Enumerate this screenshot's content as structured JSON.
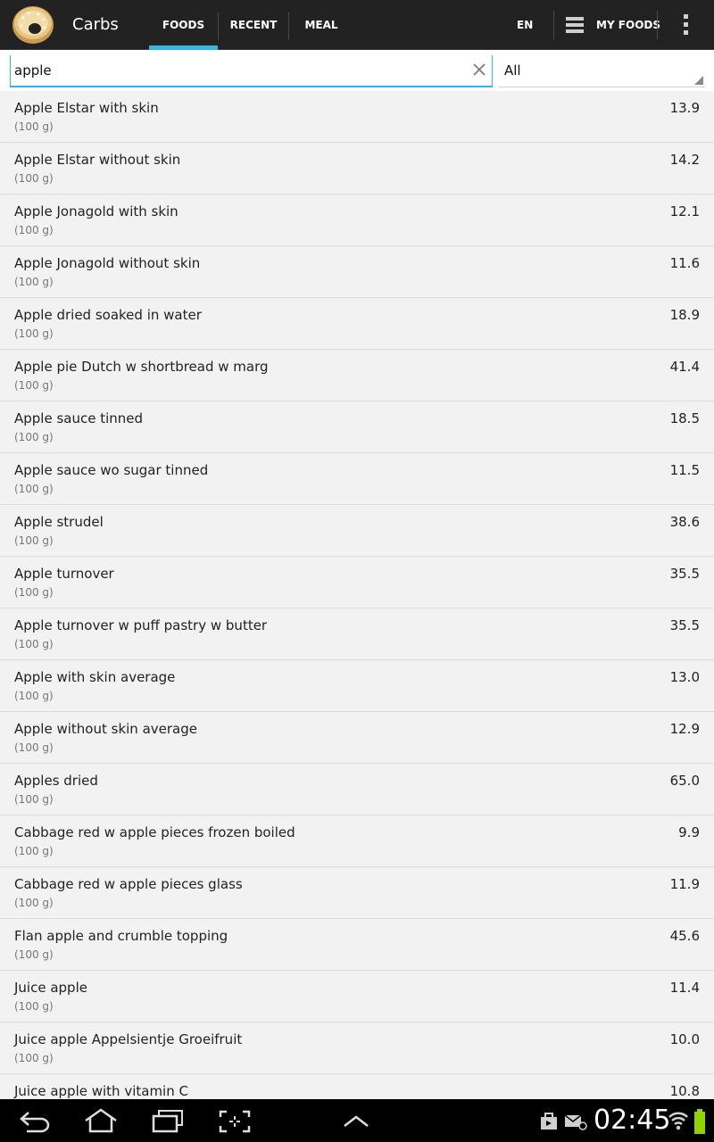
{
  "actionbar": {
    "title": "Carbs",
    "app_icon": "bagel-logo",
    "tabs": [
      {
        "label": "FOODS",
        "selected": true
      },
      {
        "label": "RECENT",
        "selected": false
      },
      {
        "label": "MEAL",
        "selected": false
      }
    ],
    "language": "EN",
    "my_foods_label": "MY FOODS",
    "overflow_icon": "overflow-menu-icon",
    "accent_color": "#33b5e5"
  },
  "search": {
    "value": "apple",
    "clear_icon": "clear-x-icon",
    "filter_value": "All"
  },
  "foods": [
    {
      "name": "Apple Elstar with skin",
      "portion": "(100 g)",
      "carbs": "13.9"
    },
    {
      "name": "Apple Elstar without skin",
      "portion": "(100 g)",
      "carbs": "14.2"
    },
    {
      "name": "Apple Jonagold with skin",
      "portion": "(100 g)",
      "carbs": "12.1"
    },
    {
      "name": "Apple Jonagold without skin",
      "portion": "(100 g)",
      "carbs": "11.6"
    },
    {
      "name": "Apple dried soaked in water",
      "portion": "(100 g)",
      "carbs": "18.9"
    },
    {
      "name": "Apple pie Dutch w shortbread w marg",
      "portion": "(100 g)",
      "carbs": "41.4"
    },
    {
      "name": "Apple sauce tinned",
      "portion": "(100 g)",
      "carbs": "18.5"
    },
    {
      "name": "Apple sauce wo sugar tinned",
      "portion": "(100 g)",
      "carbs": "11.5"
    },
    {
      "name": "Apple strudel",
      "portion": "(100 g)",
      "carbs": "38.6"
    },
    {
      "name": "Apple turnover",
      "portion": "(100 g)",
      "carbs": "35.5"
    },
    {
      "name": "Apple turnover w puff pastry w butter",
      "portion": "(100 g)",
      "carbs": "35.5"
    },
    {
      "name": "Apple with skin average",
      "portion": "(100 g)",
      "carbs": "13.0"
    },
    {
      "name": "Apple without skin average",
      "portion": "(100 g)",
      "carbs": "12.9"
    },
    {
      "name": "Apples dried",
      "portion": "(100 g)",
      "carbs": "65.0"
    },
    {
      "name": "Cabbage red w apple pieces frozen boiled",
      "portion": "(100 g)",
      "carbs": "9.9"
    },
    {
      "name": "Cabbage red w apple pieces glass",
      "portion": "(100 g)",
      "carbs": "11.9"
    },
    {
      "name": "Flan apple and crumble topping",
      "portion": "(100 g)",
      "carbs": "45.6"
    },
    {
      "name": "Juice apple",
      "portion": "(100 g)",
      "carbs": "11.4"
    },
    {
      "name": "Juice apple Appelsientje Groeifruit",
      "portion": "(100 g)",
      "carbs": "10.0"
    },
    {
      "name": "Juice apple with vitamin C",
      "portion": "(100 g)",
      "carbs": "10.8"
    }
  ],
  "system_bar": {
    "clock": "02:45",
    "icons": [
      "back-icon",
      "home-icon",
      "recents-icon",
      "screenshot-icon",
      "up-chevron-icon",
      "bag-notification-icon",
      "email-notification-icon",
      "wifi-icon",
      "battery-icon"
    ]
  }
}
